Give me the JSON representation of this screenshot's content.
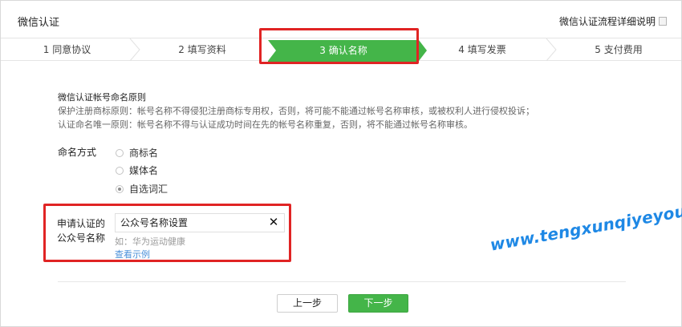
{
  "header": {
    "title": "微信认证",
    "help_link": "微信认证流程详细说明",
    "help_icon": "document-icon"
  },
  "steps": [
    {
      "label": "1 同意协议",
      "active": false
    },
    {
      "label": "2 填写资料",
      "active": false
    },
    {
      "label": "3 确认名称",
      "active": true
    },
    {
      "label": "4 填写发票",
      "active": false
    },
    {
      "label": "5 支付费用",
      "active": false
    }
  ],
  "rules": {
    "title": "微信认证帐号命名原则",
    "line1": "保护注册商标原则：帐号名称不得侵犯注册商标专用权，否则，将可能不能通过帐号名称审核，或被权利人进行侵权投诉；",
    "line2": "认证命名唯一原则：帐号名称不得与认证成功时间在先的帐号名称重复，否则，将不能通过帐号名称审核。"
  },
  "naming": {
    "label": "命名方式",
    "options": [
      {
        "label": "商标名",
        "checked": false
      },
      {
        "label": "媒体名",
        "checked": false
      },
      {
        "label": "自选词汇",
        "checked": true
      }
    ]
  },
  "apply": {
    "label": "申请认证的公众号名称",
    "value": "公众号名称设置",
    "clear_icon": "close-icon",
    "example": "如：华为运动健康",
    "example_link": "查看示例"
  },
  "buttons": {
    "prev": "上一步",
    "next": "下一步"
  },
  "watermark": "www.tengxunqiyeyou.com",
  "colors": {
    "accent": "#44b549",
    "highlight": "#e02424",
    "link": "#4a90d9",
    "watermark": "#1e88e5"
  }
}
